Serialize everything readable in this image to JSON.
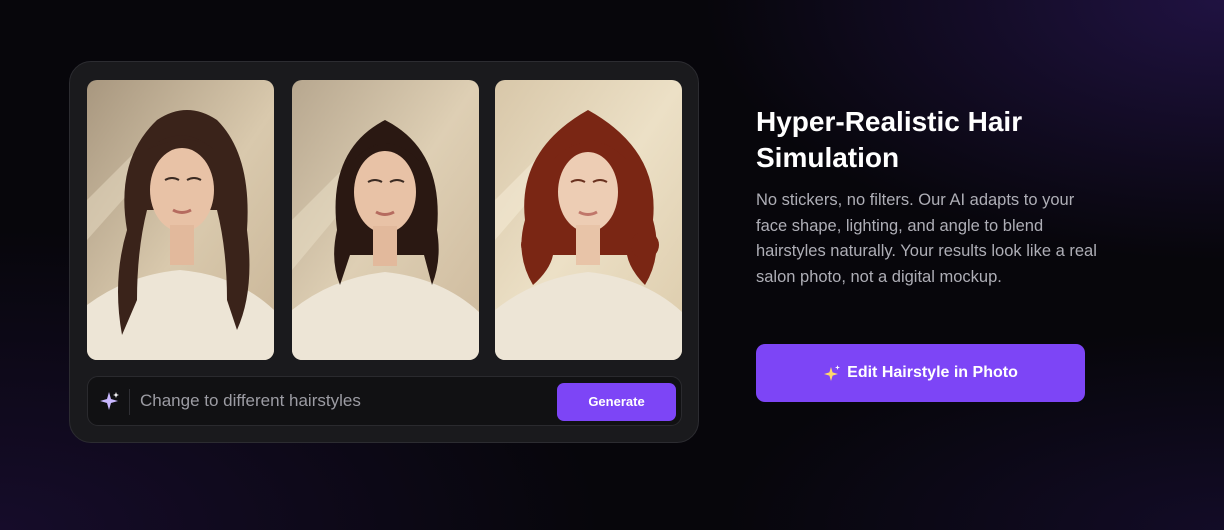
{
  "gallery": {
    "photos": [
      {
        "alt": "long-dark-wavy-hair",
        "hair_color": "#3a231a"
      },
      {
        "alt": "dark-bob-hair",
        "hair_color": "#2a1812"
      },
      {
        "alt": "auburn-curly-bob-hair",
        "hair_color": "#7a2614"
      }
    ]
  },
  "prompt": {
    "text": "Change to different hairstyles",
    "generate_label": "Generate"
  },
  "feature": {
    "title": "Hyper-Realistic Hair Simulation",
    "description": "No stickers, no filters. Our AI adapts to your face shape, lighting, and angle to blend hairstyles naturally. Your results look like a real salon photo, not a digital mockup.",
    "cta_label": "Edit Hairstyle in Photo"
  },
  "colors": {
    "accent": "#7d45f6",
    "background": "#07060b",
    "card": "#1a1a1d"
  },
  "icons": {
    "prompt": "sparkle-icon",
    "cta": "sparkle-icon"
  }
}
